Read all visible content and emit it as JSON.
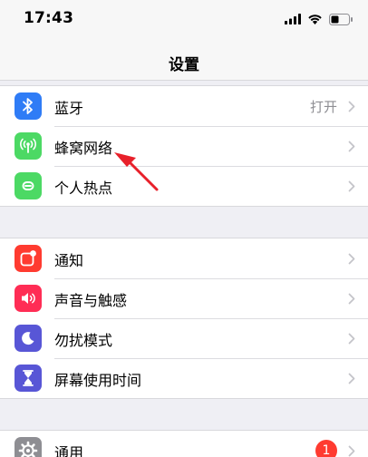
{
  "status_bar": {
    "time": "17:43",
    "signal_icon": "cellular-signal-icon",
    "wifi_icon": "wifi-icon",
    "battery_icon": "battery-icon"
  },
  "nav": {
    "title": "设置"
  },
  "groups": [
    {
      "items": [
        {
          "label": "蓝牙",
          "value": "打开",
          "icon": "bluetooth-icon",
          "icon_color": "#2f7cf6"
        },
        {
          "label": "蜂窝网络",
          "icon": "cellular-antenna-icon",
          "icon_color": "#4cd964"
        },
        {
          "label": "个人热点",
          "icon": "personal-hotspot-icon",
          "icon_color": "#4cd964"
        }
      ]
    },
    {
      "items": [
        {
          "label": "通知",
          "icon": "notifications-icon",
          "icon_color": "#ff3b30"
        },
        {
          "label": "声音与触感",
          "icon": "speaker-icon",
          "icon_color": "#ff2d55"
        },
        {
          "label": "勿扰模式",
          "icon": "moon-icon",
          "icon_color": "#5856d6"
        },
        {
          "label": "屏幕使用时间",
          "icon": "hourglass-icon",
          "icon_color": "#5856d6"
        }
      ]
    },
    {
      "items": [
        {
          "label": "通用",
          "badge": "1",
          "icon": "gear-icon",
          "icon_color": "#8e8e93"
        }
      ]
    }
  ],
  "annotation": {
    "type": "red-arrow",
    "points_to": "蜂窝网络",
    "color": "#e8202a"
  }
}
